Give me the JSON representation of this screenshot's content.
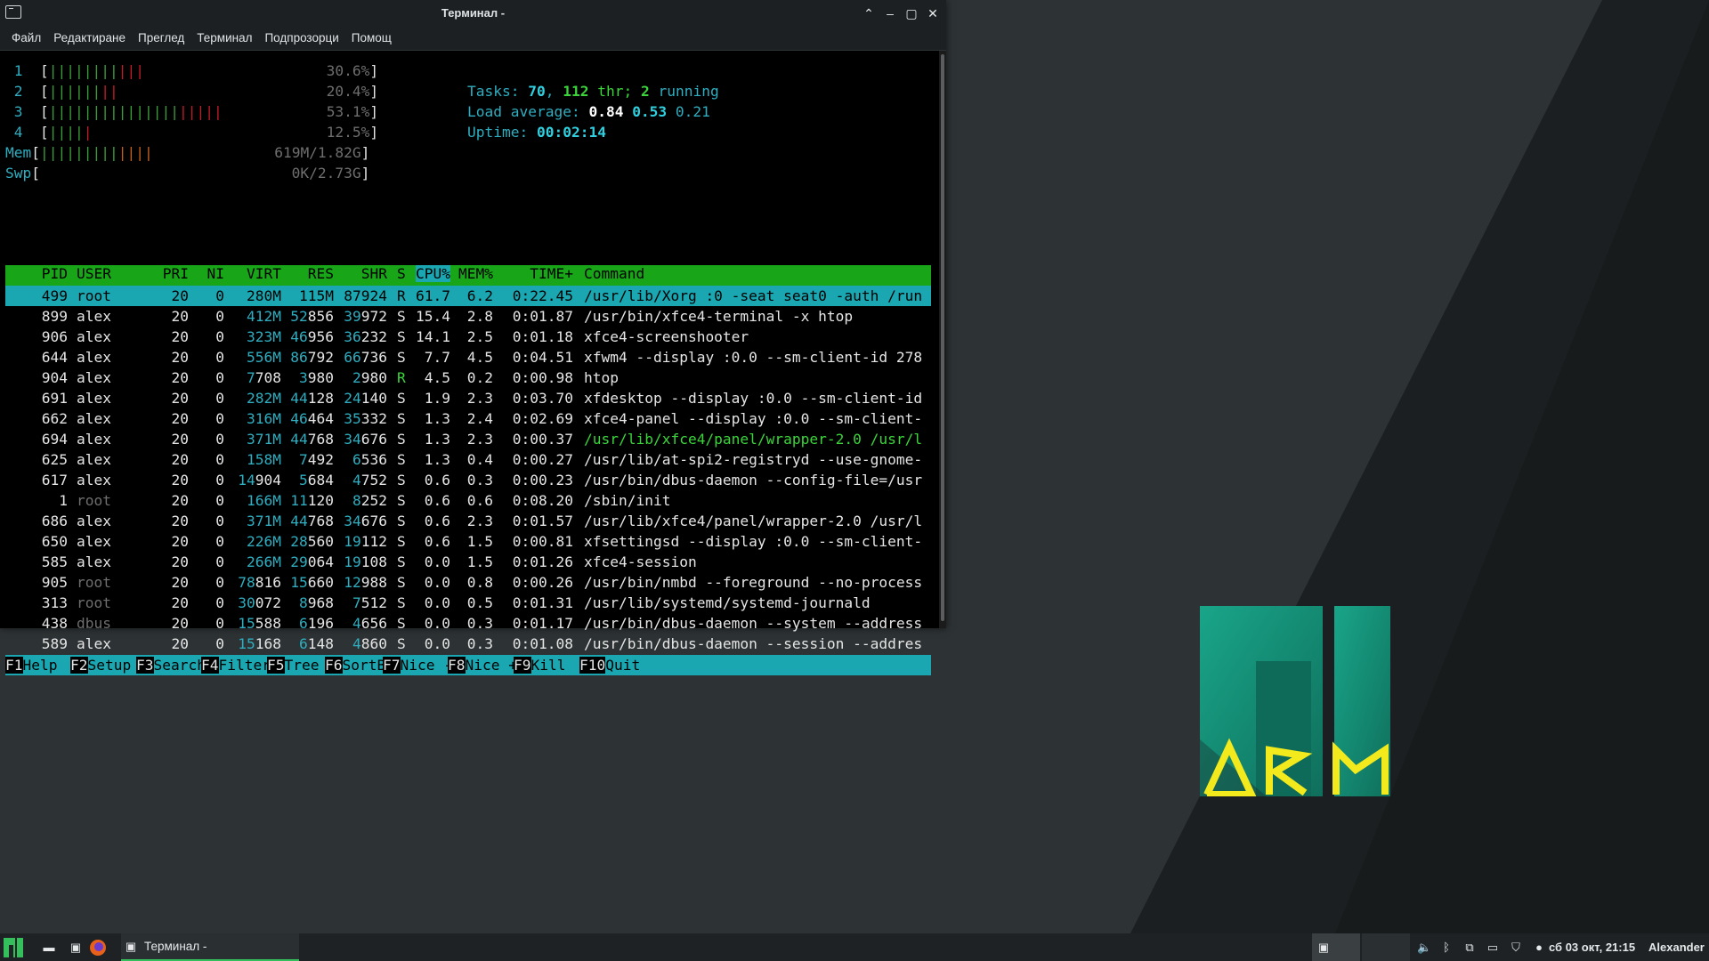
{
  "window": {
    "title": "Терминал -",
    "menu": [
      "Файл",
      "Редактиране",
      "Преглед",
      "Терминал",
      "Подпрозорци",
      "Помощ"
    ]
  },
  "meters": [
    {
      "label": "1",
      "fill_fraction": 0.306,
      "value": "30.6%]"
    },
    {
      "label": "2",
      "fill_fraction": 0.204,
      "value": "20.4%]"
    },
    {
      "label": "3",
      "fill_fraction": 0.531,
      "value": "53.1%]"
    },
    {
      "label": "4",
      "fill_fraction": 0.125,
      "value": "12.5%]"
    },
    {
      "label": "Mem",
      "fill_fraction": 0.34,
      "value": "619M/1.82G]"
    },
    {
      "label": "Swp",
      "fill_fraction": 0.0,
      "value": "0K/2.73G]"
    }
  ],
  "summary": {
    "tasks_label": "Tasks: ",
    "tasks": "70",
    "sep1": ", ",
    "threads": "112",
    "thr_label": " thr; ",
    "running": "2",
    "running_label": " running",
    "load_label": "Load average: ",
    "load1": "0.84",
    "load5": "0.53",
    "load15": "0.21",
    "uptime_label": "Uptime: ",
    "uptime": "00:02:14"
  },
  "columns": [
    "PID",
    "USER",
    "PRI",
    "NI",
    "VIRT",
    "RES",
    "SHR",
    "S",
    "CPU%",
    "MEM%",
    "TIME+",
    "Command"
  ],
  "processes": [
    {
      "pid": "499",
      "user": "root",
      "pri": "20",
      "ni": "0",
      "virt": "280M",
      "res": "115M",
      "shr": "87924",
      "s": "R",
      "cpu": "61.7",
      "mem": "6.2",
      "time": "0:22.45",
      "cmd": "/usr/lib/Xorg :0 -seat seat0 -auth /run"
    },
    {
      "pid": "899",
      "user": "alex",
      "pri": "20",
      "ni": "0",
      "virt": "412M",
      "res": "52856",
      "shr": "39972",
      "s": "S",
      "cpu": "15.4",
      "mem": "2.8",
      "time": "0:01.87",
      "cmd": "/usr/bin/xfce4-terminal -x htop"
    },
    {
      "pid": "906",
      "user": "alex",
      "pri": "20",
      "ni": "0",
      "virt": "323M",
      "res": "46956",
      "shr": "36232",
      "s": "S",
      "cpu": "14.1",
      "mem": "2.5",
      "time": "0:01.18",
      "cmd": "xfce4-screenshooter"
    },
    {
      "pid": "644",
      "user": "alex",
      "pri": "20",
      "ni": "0",
      "virt": "556M",
      "res": "86792",
      "shr": "66736",
      "s": "S",
      "cpu": "7.7",
      "mem": "4.5",
      "time": "0:04.51",
      "cmd": "xfwm4 --display :0.0 --sm-client-id 278"
    },
    {
      "pid": "904",
      "user": "alex",
      "pri": "20",
      "ni": "0",
      "virt": "7708",
      "res": "3980",
      "shr": "2980",
      "s": "R",
      "cpu": "4.5",
      "mem": "0.2",
      "time": "0:00.98",
      "cmd": "htop"
    },
    {
      "pid": "691",
      "user": "alex",
      "pri": "20",
      "ni": "0",
      "virt": "282M",
      "res": "44128",
      "shr": "24140",
      "s": "S",
      "cpu": "1.9",
      "mem": "2.3",
      "time": "0:03.70",
      "cmd": "xfdesktop --display :0.0 --sm-client-id"
    },
    {
      "pid": "662",
      "user": "alex",
      "pri": "20",
      "ni": "0",
      "virt": "316M",
      "res": "46464",
      "shr": "35332",
      "s": "S",
      "cpu": "1.3",
      "mem": "2.4",
      "time": "0:02.69",
      "cmd": "xfce4-panel --display :0.0 --sm-client-"
    },
    {
      "pid": "694",
      "user": "alex",
      "pri": "20",
      "ni": "0",
      "virt": "371M",
      "res": "44768",
      "shr": "34676",
      "s": "S",
      "cpu": "1.3",
      "mem": "2.3",
      "time": "0:00.37",
      "cmd": "/usr/lib/xfce4/panel/wrapper-2.0 /usr/l"
    },
    {
      "pid": "625",
      "user": "alex",
      "pri": "20",
      "ni": "0",
      "virt": "158M",
      "res": "7492",
      "shr": "6536",
      "s": "S",
      "cpu": "1.3",
      "mem": "0.4",
      "time": "0:00.27",
      "cmd": "/usr/lib/at-spi2-registryd --use-gnome-"
    },
    {
      "pid": "617",
      "user": "alex",
      "pri": "20",
      "ni": "0",
      "virt": "14904",
      "res": "5684",
      "shr": "4752",
      "s": "S",
      "cpu": "0.6",
      "mem": "0.3",
      "time": "0:00.23",
      "cmd": "/usr/bin/dbus-daemon --config-file=/usr"
    },
    {
      "pid": "1",
      "user": "root",
      "pri": "20",
      "ni": "0",
      "virt": "166M",
      "res": "11120",
      "shr": "8252",
      "s": "S",
      "cpu": "0.6",
      "mem": "0.6",
      "time": "0:08.20",
      "cmd": "/sbin/init"
    },
    {
      "pid": "686",
      "user": "alex",
      "pri": "20",
      "ni": "0",
      "virt": "371M",
      "res": "44768",
      "shr": "34676",
      "s": "S",
      "cpu": "0.6",
      "mem": "2.3",
      "time": "0:01.57",
      "cmd": "/usr/lib/xfce4/panel/wrapper-2.0 /usr/l"
    },
    {
      "pid": "650",
      "user": "alex",
      "pri": "20",
      "ni": "0",
      "virt": "226M",
      "res": "28560",
      "shr": "19112",
      "s": "S",
      "cpu": "0.6",
      "mem": "1.5",
      "time": "0:00.81",
      "cmd": "xfsettingsd --display :0.0 --sm-client-"
    },
    {
      "pid": "585",
      "user": "alex",
      "pri": "20",
      "ni": "0",
      "virt": "266M",
      "res": "29064",
      "shr": "19108",
      "s": "S",
      "cpu": "0.0",
      "mem": "1.5",
      "time": "0:01.26",
      "cmd": "xfce4-session"
    },
    {
      "pid": "905",
      "user": "root",
      "pri": "20",
      "ni": "0",
      "virt": "78816",
      "res": "15660",
      "shr": "12988",
      "s": "S",
      "cpu": "0.0",
      "mem": "0.8",
      "time": "0:00.26",
      "cmd": "/usr/bin/nmbd --foreground --no-process"
    },
    {
      "pid": "313",
      "user": "root",
      "pri": "20",
      "ni": "0",
      "virt": "30072",
      "res": "8968",
      "shr": "7512",
      "s": "S",
      "cpu": "0.0",
      "mem": "0.5",
      "time": "0:01.31",
      "cmd": "/usr/lib/systemd/systemd-journald"
    },
    {
      "pid": "438",
      "user": "dbus",
      "pri": "20",
      "ni": "0",
      "virt": "15588",
      "res": "6196",
      "shr": "4656",
      "s": "S",
      "cpu": "0.0",
      "mem": "0.3",
      "time": "0:01.17",
      "cmd": "/usr/bin/dbus-daemon --system --address"
    },
    {
      "pid": "589",
      "user": "alex",
      "pri": "20",
      "ni": "0",
      "virt": "15168",
      "res": "6148",
      "shr": "4860",
      "s": "S",
      "cpu": "0.0",
      "mem": "0.3",
      "time": "0:01.08",
      "cmd": "/usr/bin/dbus-daemon --session --addres"
    }
  ],
  "fkeys": [
    {
      "key": "F1",
      "label": "Help  "
    },
    {
      "key": "F2",
      "label": "Setup "
    },
    {
      "key": "F3",
      "label": "Search"
    },
    {
      "key": "F4",
      "label": "Filter"
    },
    {
      "key": "F5",
      "label": "Tree  "
    },
    {
      "key": "F6",
      "label": "SortBy"
    },
    {
      "key": "F7",
      "label": "Nice -"
    },
    {
      "key": "F8",
      "label": "Nice +"
    },
    {
      "key": "F9",
      "label": "Kill  "
    },
    {
      "key": "F10",
      "label": "Quit  "
    }
  ],
  "taskbar": {
    "task_label": "Терминал -",
    "clock": "сб 03 окт, 21:15",
    "user": "Alexander"
  },
  "colors": {
    "accent": "#35bf5c",
    "htop_header": "#18a518",
    "htop_select": "#1aa7b1",
    "logo_yellow": "#f2ea1c",
    "logo_green": "#17a086"
  }
}
